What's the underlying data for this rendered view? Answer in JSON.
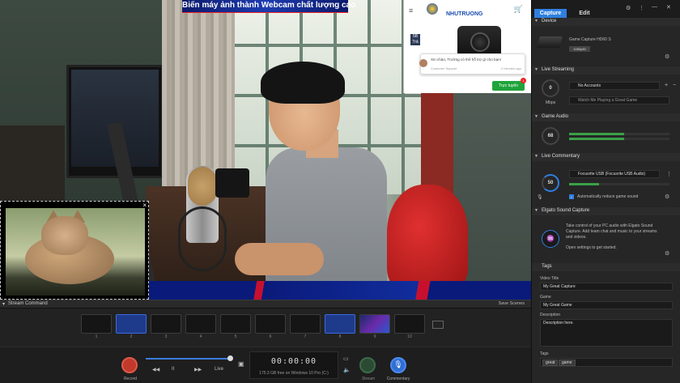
{
  "preview": {
    "banner_title": "Biến máy ảnh thành Webcam chất lượng cao",
    "cat_close": "×",
    "web": {
      "menu_icon": "hamburger-icon",
      "menu_glyph": "≡",
      "logo_text": "NHUTRUONG",
      "cart_glyph": "🛒",
      "badge_text": "5B",
      "badge_sub": "Trả",
      "chat_message": "Xin chào, Trường có thể hỗ trợ gì cho bạn!",
      "chat_sender": "Customer Support",
      "chat_time": "2 minutes ago",
      "online_button": "Trực tuyến",
      "online_count": "1"
    }
  },
  "stream_command": {
    "title": "Stream Command",
    "caret": "▾",
    "save_scenes": "Save Scenes",
    "scenes": [
      {
        "num": "1",
        "state": "empty"
      },
      {
        "num": "2",
        "state": "active"
      },
      {
        "num": "3",
        "state": "empty"
      },
      {
        "num": "4",
        "state": "empty"
      },
      {
        "num": "5",
        "state": "empty"
      },
      {
        "num": "6",
        "state": "empty"
      },
      {
        "num": "7",
        "state": "empty"
      },
      {
        "num": "8",
        "state": "active"
      },
      {
        "num": "9",
        "state": "preview"
      },
      {
        "num": "10",
        "state": "empty"
      }
    ]
  },
  "controls": {
    "record_label": "Record",
    "rewind_glyph": "◀◀",
    "pause_label": "II",
    "forward_glyph": "▶▶",
    "live_label": "Live",
    "timeline_progress": 0.98,
    "screenshot_glyph": "▣",
    "time": "00:00:00",
    "disk_free": "175.3 GB free on Windows 10 Pro (C:)",
    "monitor_glyph": "▭",
    "volume_glyph": "🔈",
    "stream_label": "Stream",
    "commentary_glyph": "🎙",
    "commentary_label": "Commentary"
  },
  "side": {
    "tabs": {
      "capture": "Capture",
      "edit": "Edit"
    },
    "top_icons": {
      "gear": "⚙",
      "info": "⋮",
      "minimize": "—",
      "close": "✕"
    },
    "device": {
      "head": "Device",
      "name": "Game Capture HD60 S",
      "resolution": "1080p60"
    },
    "live_streaming": {
      "head": "Live Streaming",
      "dial_value": "0",
      "dial_unit": "Mbps",
      "account": "No Accounts",
      "title_placeholder": "Watch Me Playing a Great Game",
      "plus": "+",
      "minus": "−"
    },
    "game_audio": {
      "head": "Game Audio",
      "dial_value": "68",
      "level": 0.55
    },
    "live_commentary": {
      "head": "Live Commentary",
      "dial_value": "50",
      "device": "Focusrite USB (Focusrite USB Audio)",
      "reduce_label": "Automatically reduce game sound",
      "level": 0.3
    },
    "sound_capture": {
      "head": "Elgato Sound Capture",
      "line1": "Take control of your PC audio with Elgato Sound",
      "line2": "Capture. Add team chat and music to your streams",
      "line3": "and videos.",
      "line4": "Open settings to get started."
    },
    "tags": {
      "head": "Tags",
      "video_title_label": "Video Title",
      "video_title": "My Great Capture",
      "game_label": "Game",
      "game": "My Great Game",
      "description_label": "Description",
      "description": "Description here.",
      "tags_label": "Tags",
      "tag_values": [
        "great",
        "game"
      ]
    }
  }
}
